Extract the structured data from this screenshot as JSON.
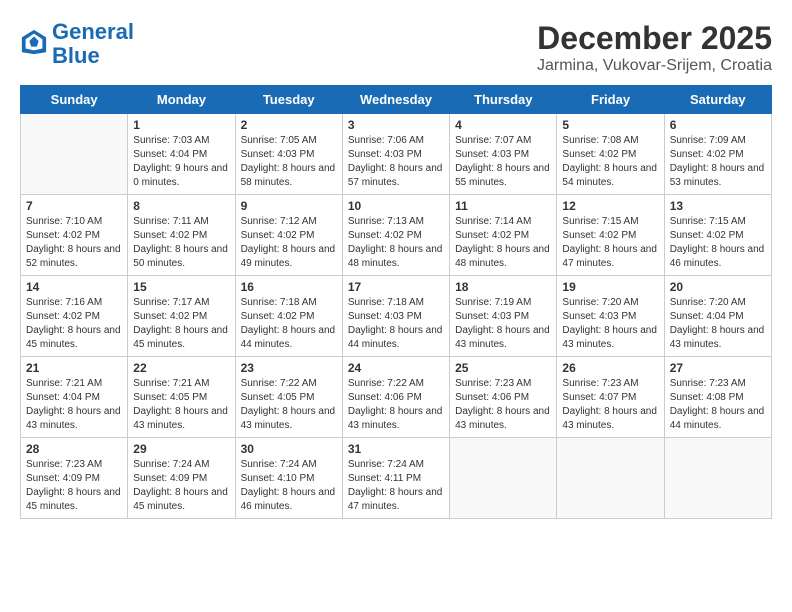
{
  "header": {
    "logo_general": "General",
    "logo_blue": "Blue",
    "title": "December 2025",
    "subtitle": "Jarmina, Vukovar-Srijem, Croatia"
  },
  "calendar": {
    "days_of_week": [
      "Sunday",
      "Monday",
      "Tuesday",
      "Wednesday",
      "Thursday",
      "Friday",
      "Saturday"
    ],
    "weeks": [
      [
        {
          "day": "",
          "sunrise": "",
          "sunset": "",
          "daylight": ""
        },
        {
          "day": "1",
          "sunrise": "Sunrise: 7:03 AM",
          "sunset": "Sunset: 4:04 PM",
          "daylight": "Daylight: 9 hours and 0 minutes."
        },
        {
          "day": "2",
          "sunrise": "Sunrise: 7:05 AM",
          "sunset": "Sunset: 4:03 PM",
          "daylight": "Daylight: 8 hours and 58 minutes."
        },
        {
          "day": "3",
          "sunrise": "Sunrise: 7:06 AM",
          "sunset": "Sunset: 4:03 PM",
          "daylight": "Daylight: 8 hours and 57 minutes."
        },
        {
          "day": "4",
          "sunrise": "Sunrise: 7:07 AM",
          "sunset": "Sunset: 4:03 PM",
          "daylight": "Daylight: 8 hours and 55 minutes."
        },
        {
          "day": "5",
          "sunrise": "Sunrise: 7:08 AM",
          "sunset": "Sunset: 4:02 PM",
          "daylight": "Daylight: 8 hours and 54 minutes."
        },
        {
          "day": "6",
          "sunrise": "Sunrise: 7:09 AM",
          "sunset": "Sunset: 4:02 PM",
          "daylight": "Daylight: 8 hours and 53 minutes."
        }
      ],
      [
        {
          "day": "7",
          "sunrise": "Sunrise: 7:10 AM",
          "sunset": "Sunset: 4:02 PM",
          "daylight": "Daylight: 8 hours and 52 minutes."
        },
        {
          "day": "8",
          "sunrise": "Sunrise: 7:11 AM",
          "sunset": "Sunset: 4:02 PM",
          "daylight": "Daylight: 8 hours and 50 minutes."
        },
        {
          "day": "9",
          "sunrise": "Sunrise: 7:12 AM",
          "sunset": "Sunset: 4:02 PM",
          "daylight": "Daylight: 8 hours and 49 minutes."
        },
        {
          "day": "10",
          "sunrise": "Sunrise: 7:13 AM",
          "sunset": "Sunset: 4:02 PM",
          "daylight": "Daylight: 8 hours and 48 minutes."
        },
        {
          "day": "11",
          "sunrise": "Sunrise: 7:14 AM",
          "sunset": "Sunset: 4:02 PM",
          "daylight": "Daylight: 8 hours and 48 minutes."
        },
        {
          "day": "12",
          "sunrise": "Sunrise: 7:15 AM",
          "sunset": "Sunset: 4:02 PM",
          "daylight": "Daylight: 8 hours and 47 minutes."
        },
        {
          "day": "13",
          "sunrise": "Sunrise: 7:15 AM",
          "sunset": "Sunset: 4:02 PM",
          "daylight": "Daylight: 8 hours and 46 minutes."
        }
      ],
      [
        {
          "day": "14",
          "sunrise": "Sunrise: 7:16 AM",
          "sunset": "Sunset: 4:02 PM",
          "daylight": "Daylight: 8 hours and 45 minutes."
        },
        {
          "day": "15",
          "sunrise": "Sunrise: 7:17 AM",
          "sunset": "Sunset: 4:02 PM",
          "daylight": "Daylight: 8 hours and 45 minutes."
        },
        {
          "day": "16",
          "sunrise": "Sunrise: 7:18 AM",
          "sunset": "Sunset: 4:02 PM",
          "daylight": "Daylight: 8 hours and 44 minutes."
        },
        {
          "day": "17",
          "sunrise": "Sunrise: 7:18 AM",
          "sunset": "Sunset: 4:03 PM",
          "daylight": "Daylight: 8 hours and 44 minutes."
        },
        {
          "day": "18",
          "sunrise": "Sunrise: 7:19 AM",
          "sunset": "Sunset: 4:03 PM",
          "daylight": "Daylight: 8 hours and 43 minutes."
        },
        {
          "day": "19",
          "sunrise": "Sunrise: 7:20 AM",
          "sunset": "Sunset: 4:03 PM",
          "daylight": "Daylight: 8 hours and 43 minutes."
        },
        {
          "day": "20",
          "sunrise": "Sunrise: 7:20 AM",
          "sunset": "Sunset: 4:04 PM",
          "daylight": "Daylight: 8 hours and 43 minutes."
        }
      ],
      [
        {
          "day": "21",
          "sunrise": "Sunrise: 7:21 AM",
          "sunset": "Sunset: 4:04 PM",
          "daylight": "Daylight: 8 hours and 43 minutes."
        },
        {
          "day": "22",
          "sunrise": "Sunrise: 7:21 AM",
          "sunset": "Sunset: 4:05 PM",
          "daylight": "Daylight: 8 hours and 43 minutes."
        },
        {
          "day": "23",
          "sunrise": "Sunrise: 7:22 AM",
          "sunset": "Sunset: 4:05 PM",
          "daylight": "Daylight: 8 hours and 43 minutes."
        },
        {
          "day": "24",
          "sunrise": "Sunrise: 7:22 AM",
          "sunset": "Sunset: 4:06 PM",
          "daylight": "Daylight: 8 hours and 43 minutes."
        },
        {
          "day": "25",
          "sunrise": "Sunrise: 7:23 AM",
          "sunset": "Sunset: 4:06 PM",
          "daylight": "Daylight: 8 hours and 43 minutes."
        },
        {
          "day": "26",
          "sunrise": "Sunrise: 7:23 AM",
          "sunset": "Sunset: 4:07 PM",
          "daylight": "Daylight: 8 hours and 43 minutes."
        },
        {
          "day": "27",
          "sunrise": "Sunrise: 7:23 AM",
          "sunset": "Sunset: 4:08 PM",
          "daylight": "Daylight: 8 hours and 44 minutes."
        }
      ],
      [
        {
          "day": "28",
          "sunrise": "Sunrise: 7:23 AM",
          "sunset": "Sunset: 4:09 PM",
          "daylight": "Daylight: 8 hours and 45 minutes."
        },
        {
          "day": "29",
          "sunrise": "Sunrise: 7:24 AM",
          "sunset": "Sunset: 4:09 PM",
          "daylight": "Daylight: 8 hours and 45 minutes."
        },
        {
          "day": "30",
          "sunrise": "Sunrise: 7:24 AM",
          "sunset": "Sunset: 4:10 PM",
          "daylight": "Daylight: 8 hours and 46 minutes."
        },
        {
          "day": "31",
          "sunrise": "Sunrise: 7:24 AM",
          "sunset": "Sunset: 4:11 PM",
          "daylight": "Daylight: 8 hours and 47 minutes."
        },
        {
          "day": "",
          "sunrise": "",
          "sunset": "",
          "daylight": ""
        },
        {
          "day": "",
          "sunrise": "",
          "sunset": "",
          "daylight": ""
        },
        {
          "day": "",
          "sunrise": "",
          "sunset": "",
          "daylight": ""
        }
      ]
    ]
  }
}
